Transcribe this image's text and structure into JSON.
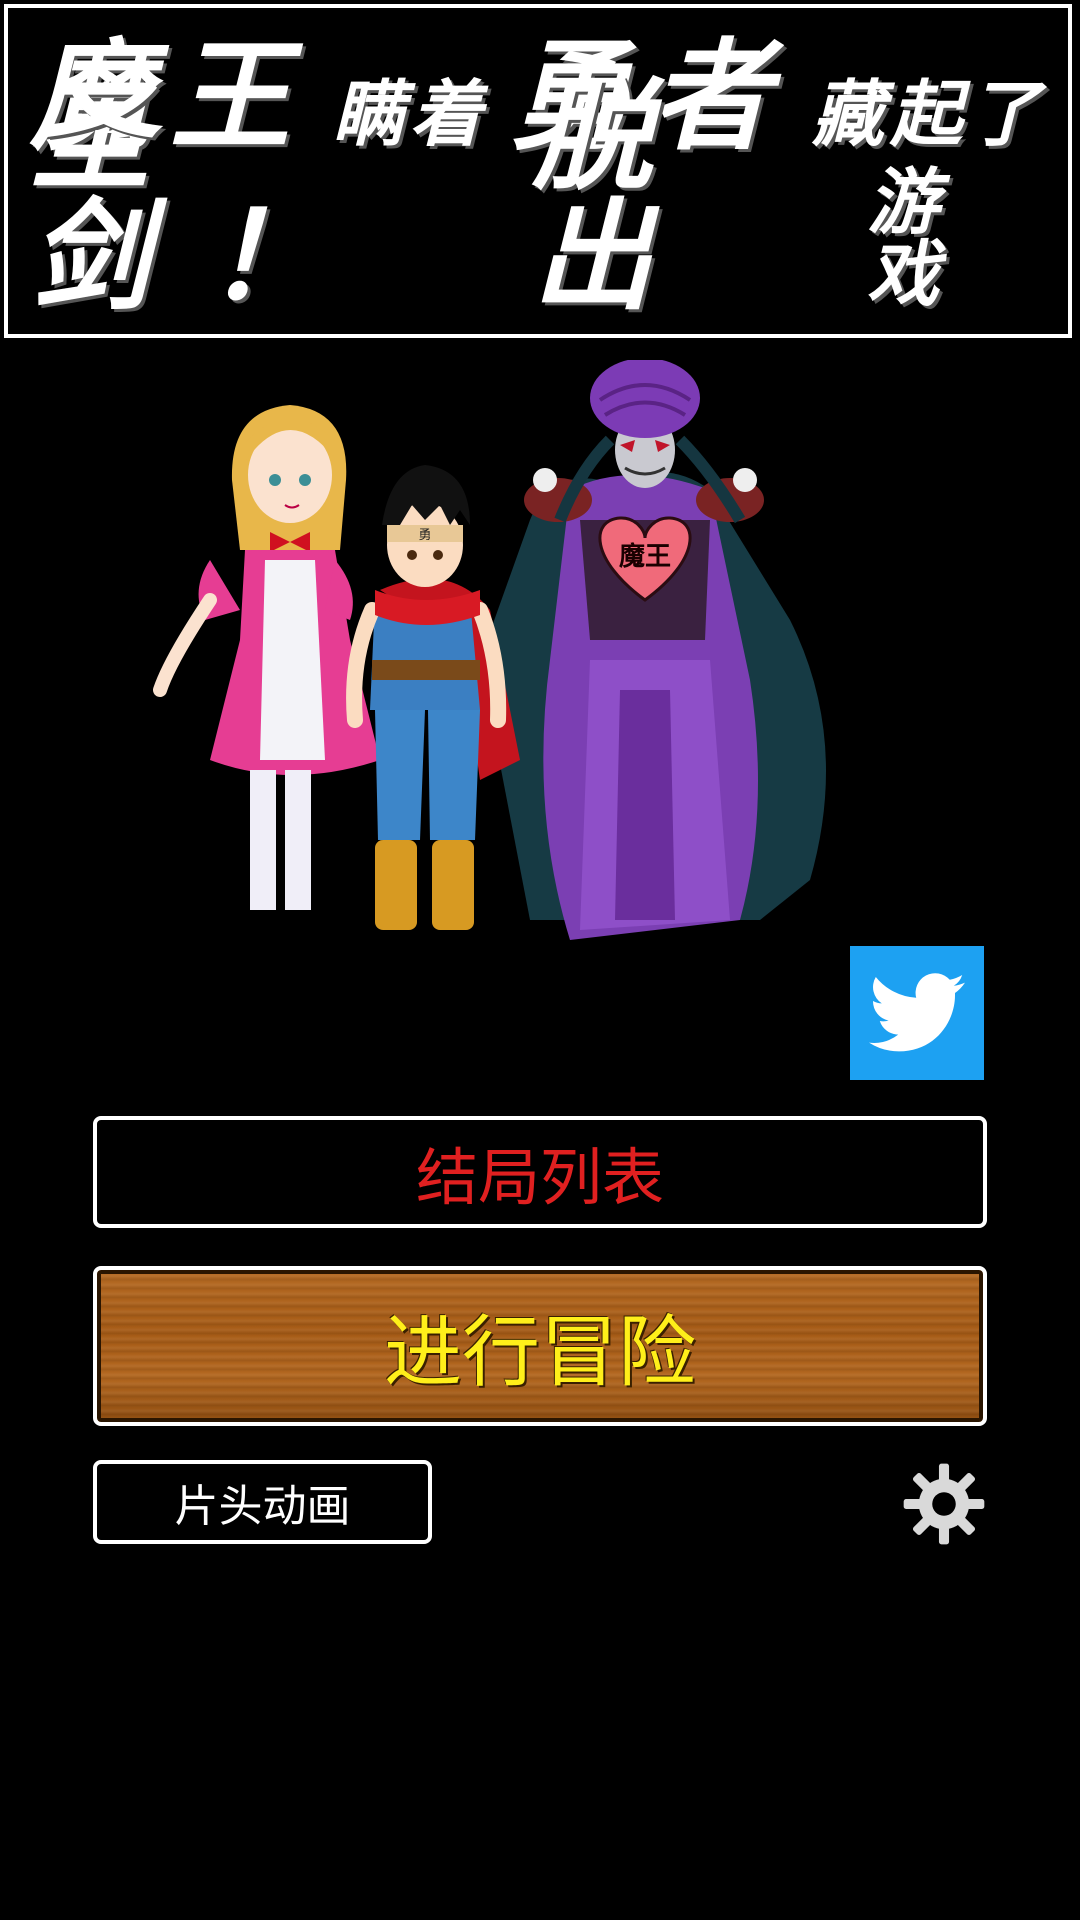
{
  "title": {
    "line1": [
      {
        "text": "魔王",
        "size": "big"
      },
      {
        "text": "瞒着",
        "size": "small"
      },
      {
        "text": "勇者",
        "size": "big"
      },
      {
        "text": "藏起了",
        "size": "small"
      }
    ],
    "line2": [
      {
        "text": "圣剑！",
        "size": "big"
      },
      {
        "text": "脱出",
        "size": "big"
      },
      {
        "text": "游戏",
        "size": "small"
      }
    ]
  },
  "characters": {
    "demon_chest_text": "魔王",
    "hero_headband_text": "勇"
  },
  "buttons": {
    "endings_label": "结局列表",
    "adventure_label": "进行冒险",
    "opening_label": "片头动画"
  },
  "icons": {
    "twitter": "twitter-bird-icon",
    "settings": "gear-icon"
  },
  "colors": {
    "twitter": "#1da1f2",
    "endings_text": "#e02020",
    "adventure_text": "#ffef1a",
    "adventure_wood": "#a65b16"
  }
}
